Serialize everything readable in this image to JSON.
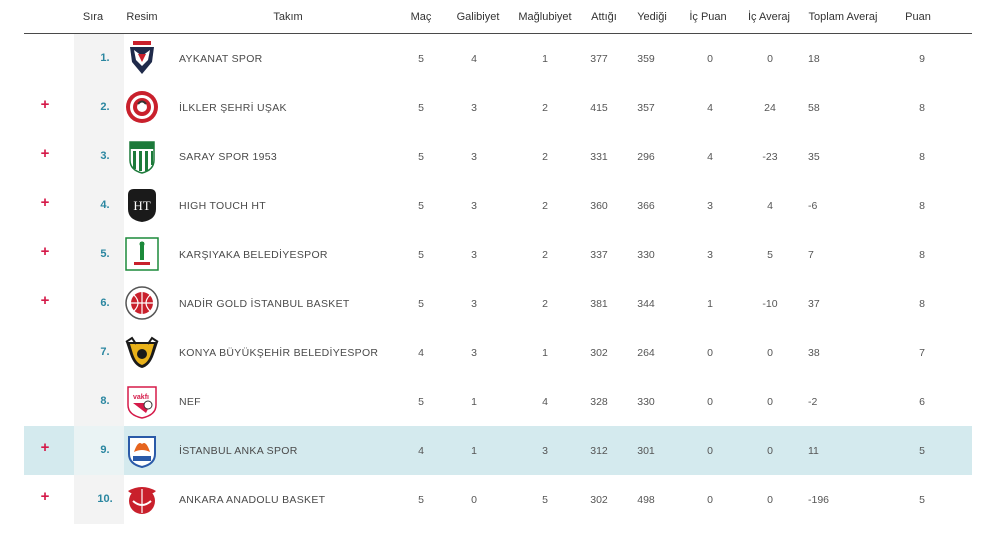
{
  "columns": {
    "sira": "Sıra",
    "resim": "Resim",
    "takim": "Takım",
    "mac": "Maç",
    "galibiyet": "Galibiyet",
    "maglubiyet": "Mağlubiyet",
    "attigi": "Attığı",
    "yedigi": "Yediği",
    "ic_puan": "İç Puan",
    "ic_averaj": "İç Averaj",
    "toplam_averaj": "Toplam Averaj",
    "puan": "Puan"
  },
  "plus_symbol": "+",
  "rows": [
    {
      "rank": "1.",
      "team": "AYKANAT SPOR",
      "mac": "5",
      "g": "4",
      "m": "1",
      "attigi": "377",
      "yedigi": "359",
      "ic_puan": "0",
      "ic_averaj": "0",
      "toplam": "18",
      "puan": "9",
      "expand": false,
      "highlight": false
    },
    {
      "rank": "2.",
      "team": "İLKLER ŞEHRİ UŞAK",
      "mac": "5",
      "g": "3",
      "m": "2",
      "attigi": "415",
      "yedigi": "357",
      "ic_puan": "4",
      "ic_averaj": "24",
      "toplam": "58",
      "puan": "8",
      "expand": true,
      "highlight": false
    },
    {
      "rank": "3.",
      "team": "SARAY SPOR 1953",
      "mac": "5",
      "g": "3",
      "m": "2",
      "attigi": "331",
      "yedigi": "296",
      "ic_puan": "4",
      "ic_averaj": "-23",
      "toplam": "35",
      "puan": "8",
      "expand": true,
      "highlight": false
    },
    {
      "rank": "4.",
      "team": "HIGH TOUCH HT",
      "mac": "5",
      "g": "3",
      "m": "2",
      "attigi": "360",
      "yedigi": "366",
      "ic_puan": "3",
      "ic_averaj": "4",
      "toplam": "-6",
      "puan": "8",
      "expand": true,
      "highlight": false
    },
    {
      "rank": "5.",
      "team": "KARŞIYAKA BELEDİYESPOR",
      "mac": "5",
      "g": "3",
      "m": "2",
      "attigi": "337",
      "yedigi": "330",
      "ic_puan": "3",
      "ic_averaj": "5",
      "toplam": "7",
      "puan": "8",
      "expand": true,
      "highlight": false
    },
    {
      "rank": "6.",
      "team": "NADİR GOLD İSTANBUL BASKET",
      "mac": "5",
      "g": "3",
      "m": "2",
      "attigi": "381",
      "yedigi": "344",
      "ic_puan": "1",
      "ic_averaj": "-10",
      "toplam": "37",
      "puan": "8",
      "expand": true,
      "highlight": false
    },
    {
      "rank": "7.",
      "team": "KONYA BÜYÜKŞEHİR BELEDİYESPOR",
      "mac": "4",
      "g": "3",
      "m": "1",
      "attigi": "302",
      "yedigi": "264",
      "ic_puan": "0",
      "ic_averaj": "0",
      "toplam": "38",
      "puan": "7",
      "expand": false,
      "highlight": false
    },
    {
      "rank": "8.",
      "team": "NEF",
      "mac": "5",
      "g": "1",
      "m": "4",
      "attigi": "328",
      "yedigi": "330",
      "ic_puan": "0",
      "ic_averaj": "0",
      "toplam": "-2",
      "puan": "6",
      "expand": false,
      "highlight": false
    },
    {
      "rank": "9.",
      "team": "İSTANBUL ANKA SPOR",
      "mac": "4",
      "g": "1",
      "m": "3",
      "attigi": "312",
      "yedigi": "301",
      "ic_puan": "0",
      "ic_averaj": "0",
      "toplam": "11",
      "puan": "5",
      "expand": true,
      "highlight": true
    },
    {
      "rank": "10.",
      "team": "ANKARA ANADOLU BASKET",
      "mac": "5",
      "g": "0",
      "m": "5",
      "attigi": "302",
      "yedigi": "498",
      "ic_puan": "0",
      "ic_averaj": "0",
      "toplam": "-196",
      "puan": "5",
      "expand": true,
      "highlight": false
    }
  ],
  "logos": [
    {
      "icon": "aykanat-eagle-logo",
      "colors": [
        "#1f2a4a",
        "#c9202c"
      ]
    },
    {
      "icon": "ilkler-sehri-usak-logo",
      "colors": [
        "#c9202c",
        "#ffffff"
      ]
    },
    {
      "icon": "saray-spor-logo",
      "colors": [
        "#1c7a3a",
        "#ffffff"
      ]
    },
    {
      "icon": "high-touch-ht-logo",
      "colors": [
        "#1a1a1a",
        "#ffffff"
      ]
    },
    {
      "icon": "karsiyaka-belediyespor-logo",
      "colors": [
        "#1c8a3a",
        "#c9202c"
      ]
    },
    {
      "icon": "nadir-gold-istanbul-basket-logo",
      "colors": [
        "#c9202c",
        "#555555"
      ]
    },
    {
      "icon": "konya-buyuksehir-logo",
      "colors": [
        "#e9b21a",
        "#1a1a1a"
      ]
    },
    {
      "icon": "nef-vakfi-logo",
      "colors": [
        "#d51a49",
        "#ffffff"
      ]
    },
    {
      "icon": "istanbul-anka-spor-logo",
      "colors": [
        "#2a5aa8",
        "#e6641e"
      ]
    },
    {
      "icon": "ankara-anadolu-basket-logo",
      "colors": [
        "#c9202c",
        "#ffffff"
      ]
    }
  ],
  "colors": {
    "rank_text": "#2a86a0",
    "plus": "#d51a49",
    "highlight_row": "#d4eaee"
  }
}
